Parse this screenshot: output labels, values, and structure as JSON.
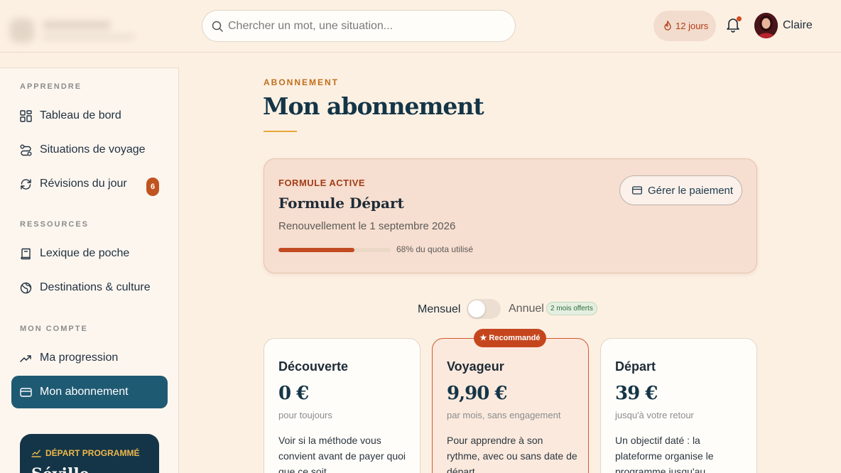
{
  "header": {
    "search_placeholder": "Chercher un mot, une situation...",
    "streak": "12 jours",
    "user_name": "Claire"
  },
  "sidebar": {
    "sections": [
      {
        "label": "APPRENDRE",
        "items": [
          {
            "label": "Tableau de bord",
            "icon": "grid-icon"
          },
          {
            "label": "Situations de voyage",
            "icon": "route-icon"
          },
          {
            "label": "Révisions du jour",
            "icon": "refresh-icon",
            "badge": "6"
          }
        ]
      },
      {
        "label": "RESSOURCES",
        "items": [
          {
            "label": "Lexique de poche",
            "icon": "book-icon"
          },
          {
            "label": "Destinations & culture",
            "icon": "globe-icon"
          }
        ]
      },
      {
        "label": "MON COMPTE",
        "items": [
          {
            "label": "Ma progression",
            "icon": "trending-up-icon"
          },
          {
            "label": "Mon abonnement",
            "icon": "card-icon",
            "active": true
          }
        ]
      }
    ],
    "depart_card": {
      "title": "DÉPART PROGRAMMÉ",
      "city": "Séville"
    }
  },
  "main": {
    "eyebrow": "ABONNEMENT",
    "title": "Mon abonnement",
    "active_plan": {
      "tag": "FORMULE ACTIVE",
      "name": "Formule Départ",
      "renewal": "Renouvellement le 1 septembre 2026",
      "quota_percent": 68,
      "quota_text": "68% du quota utilisé",
      "manage_button": "Gérer le paiement"
    },
    "billing": {
      "monthly": "Mensuel",
      "annual": "Annuel",
      "offer": "2 mois offerts",
      "annual_selected": false
    },
    "recommended_label": "★ Recommandé",
    "plans": [
      {
        "name": "Découverte",
        "price": "0 €",
        "period": "pour toujours",
        "description": "Voir si la méthode vous convient avant de payer quoi que ce soit."
      },
      {
        "name": "Voyageur",
        "price": "9,90 €",
        "period": "par mois, sans engagement",
        "description": "Pour apprendre à son rythme, avec ou sans date de départ."
      },
      {
        "name": "Départ",
        "price": "39 €",
        "period": "jusqu'à votre retour",
        "description": "Un objectif daté : la plateforme organise le programme jusqu'au décollage."
      }
    ]
  },
  "colors": {
    "background": "#fcf0e3",
    "primary": "#1f5a73",
    "accent": "#c5461d",
    "gold": "#e7a93a"
  }
}
